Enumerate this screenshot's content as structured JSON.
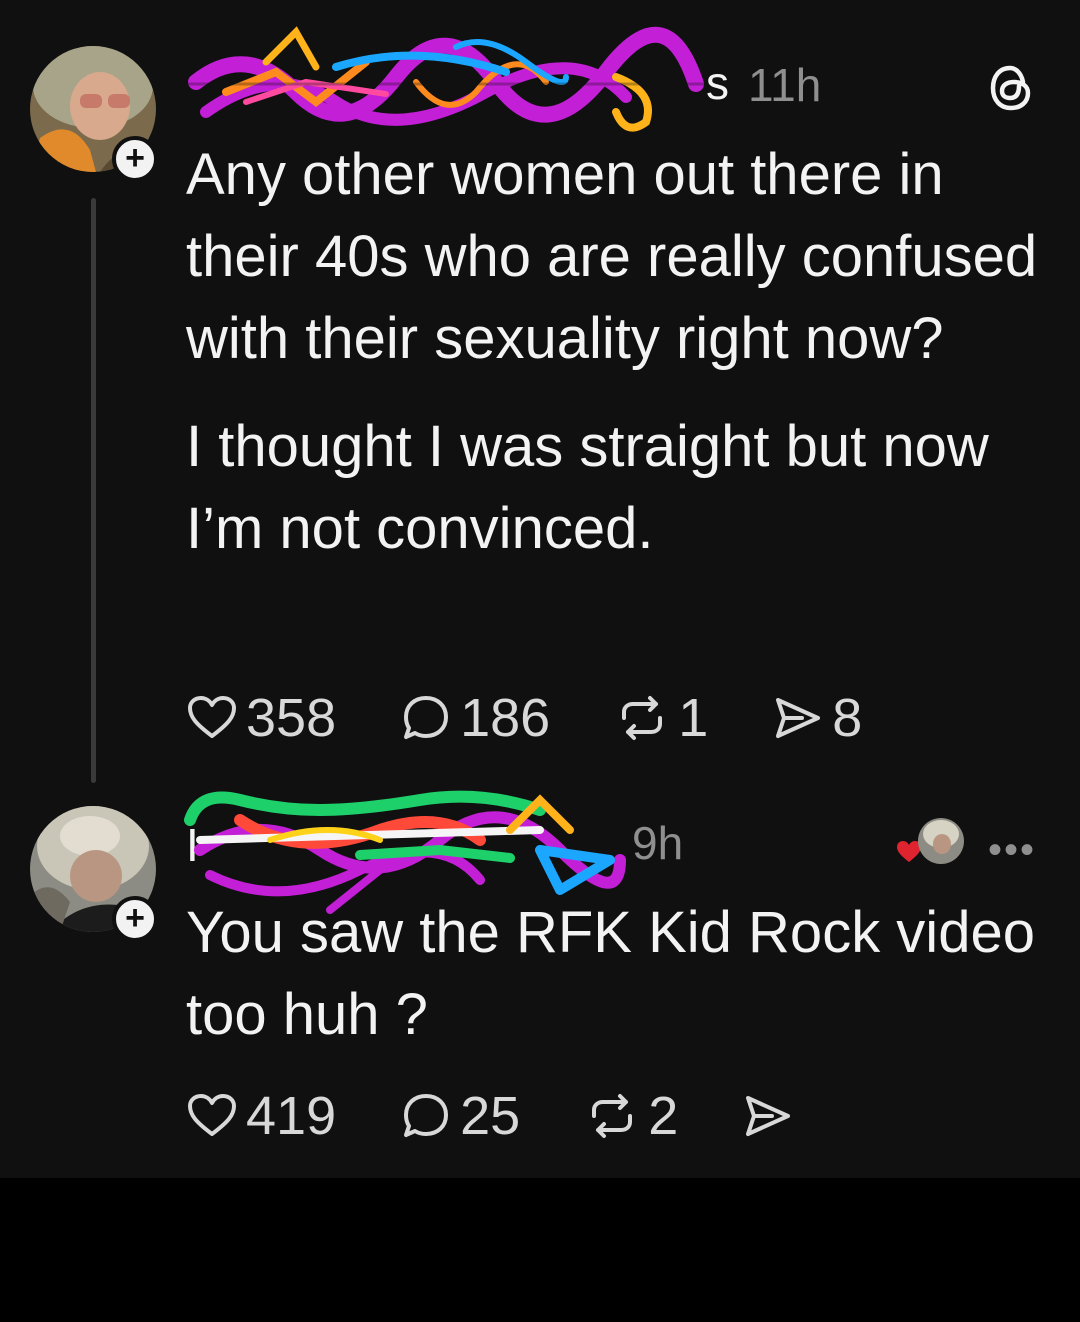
{
  "posts": [
    {
      "handle_visible": "s",
      "time": "11h",
      "paragraphs": [
        "Any other women out there in their 40s who are really confused with their sexuality right now?",
        "I thought I was straight but now I’m not convinced."
      ],
      "likes": "358",
      "replies": "186",
      "reposts": "1",
      "shares": "8"
    },
    {
      "handle_visible": "I",
      "time": "9h",
      "paragraphs": [
        "You saw the RFK Kid Rock video too huh ?"
      ],
      "likes": "419",
      "replies": "25",
      "reposts": "2",
      "shares": ""
    }
  ],
  "icons": {
    "header": "threads-logo-icon",
    "follow": "plus-icon",
    "like": "heart-icon",
    "reply": "comment-icon",
    "repost": "repost-icon",
    "share": "send-icon",
    "more": "more-icon"
  },
  "colors": {
    "background": "#101010",
    "text": "#f3f3f3",
    "muted": "#8f8f8f",
    "thread_line": "#3a3a3a"
  }
}
